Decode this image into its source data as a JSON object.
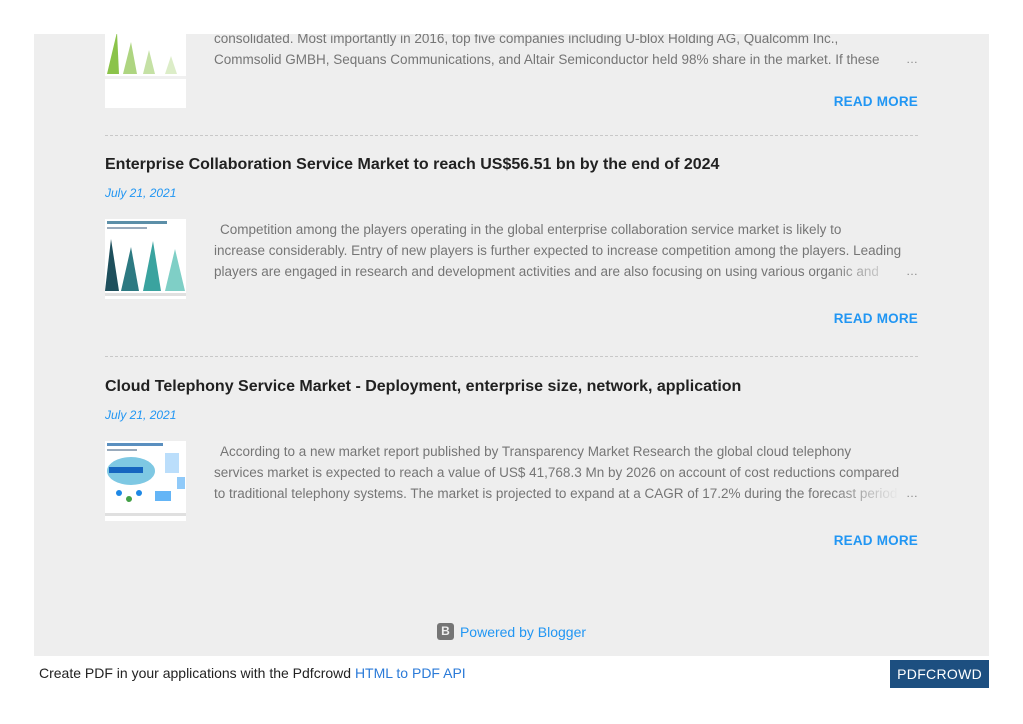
{
  "posts": [
    {
      "title": "",
      "date": "",
      "snippet_lines": [
        "consolidated. Most importantly in 2016, top five companies including U-blox Holding AG, Qualcomm Inc.,",
        "Commsolid GMBH, Sequans Communications, and Altair Semiconductor held 98% share in the market. If these"
      ],
      "read_more": "READ MORE"
    },
    {
      "title": "Enterprise Collaboration Service Market to reach US$56.51 bn by the end of 2024",
      "date": "July 21, 2021",
      "snippet_lines": [
        "Competition among the players operating in the global  enterprise collaboration service market  is likely to",
        "increase considerably. Entry of new players is further expected to increase competition among the players. Leading",
        "players are engaged in research and development activities and are also focusing on using various organic and"
      ],
      "read_more": "READ MORE"
    },
    {
      "title": "Cloud Telephony Service Market - Deployment, enterprise size, network, application",
      "date": "July 21, 2021",
      "snippet_lines": [
        "According to a new market report published by Transparency Market Research  the  global cloud telephony",
        "services market  is expected to reach a value of US$ 41,768.3 Mn by 2026 on account of cost reductions compared",
        "to traditional telephony systems. The market is projected to expand at a CAGR of 17.2% during the forecast period"
      ],
      "read_more": "READ MORE"
    }
  ],
  "ellipsis": "…",
  "footer": {
    "label": "Powered by Blogger",
    "icon": "blogger-icon"
  },
  "pdf_bar": {
    "text": "Create PDF in your applications with the Pdfcrowd",
    "link": "HTML to PDF API",
    "button": "PDFCROWD"
  }
}
